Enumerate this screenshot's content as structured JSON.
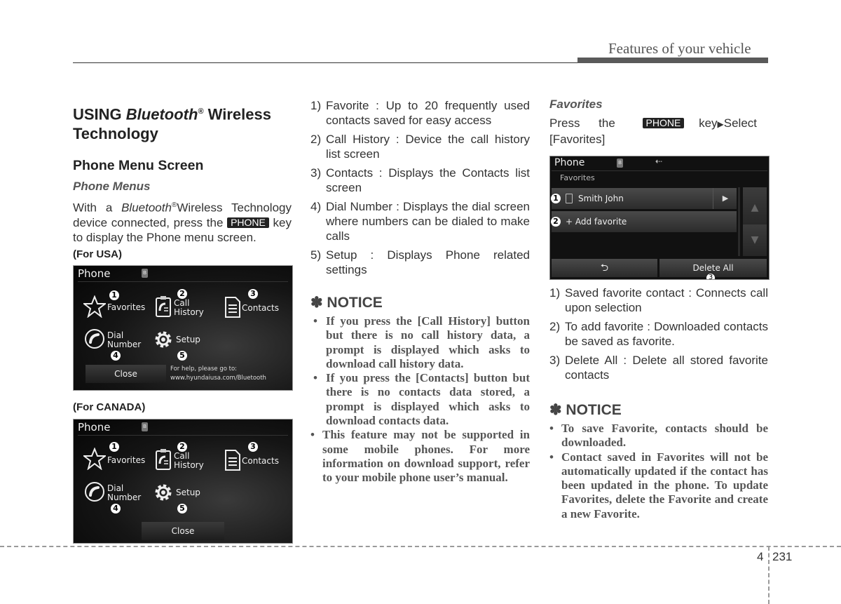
{
  "header": {
    "section_title": "Features of your vehicle"
  },
  "left": {
    "heading_prefix": "USING ",
    "heading_brand": "Bluetooth",
    "heading_reg": "®",
    "heading_suffix": " Wireless Technology",
    "subheading": "Phone Menu Screen",
    "subsubheading": "Phone Menus",
    "intro_1": "With a ",
    "intro_brand": "Bluetooth",
    "intro_reg": "®",
    "intro_2": "Wireless Technology device connected, press the ",
    "intro_key": "PHONE",
    "intro_3": " key to display the Phone menu screen.",
    "usa_label": "(For USA)",
    "canada_label": "(For CANADA)"
  },
  "phone_screen": {
    "title": "Phone",
    "bt_icon": "bluetooth-icon",
    "items": [
      {
        "num": "1",
        "label_1": "Favorites",
        "label_2": "",
        "icon": "star-icon"
      },
      {
        "num": "2",
        "label_1": "Call",
        "label_2": "History",
        "icon": "call-history-icon"
      },
      {
        "num": "3",
        "label_1": "Contacts",
        "label_2": "",
        "icon": "contacts-icon"
      },
      {
        "num": "4",
        "label_1": "Dial",
        "label_2": "Number",
        "icon": "phone-dial-icon"
      },
      {
        "num": "5",
        "label_1": "Setup",
        "label_2": "",
        "icon": "gear-icon"
      }
    ],
    "close_label": "Close",
    "help_line_1": "For help, please go to:",
    "help_line_2": "www.hyundaiusa.com/Bluetooth"
  },
  "middle": {
    "items": [
      {
        "n": "1)",
        "text": "Favorite : Up to 20 frequently used contacts saved for easy access"
      },
      {
        "n": "2)",
        "text": "Call History : Device the call history list screen"
      },
      {
        "n": "3)",
        "text": "Contacts : Displays the Contacts list screen"
      },
      {
        "n": "4)",
        "text": "Dial Number : Displays the dial screen where numbers can be dialed to make calls"
      },
      {
        "n": "5)",
        "text": "Setup : Displays Phone related settings"
      }
    ],
    "notice_title": "✽ NOTICE",
    "notice_bullets": [
      "If you press the [Call History] button but there is no call history data, a prompt is displayed which asks to download call history data.",
      "If you press the [Contacts] button but there is no contacts data stored, a prompt is displayed which asks to download contacts data.",
      "This feature may not be supported in some mobile phones. For more information on download support, refer to your mobile phone user’s manual."
    ]
  },
  "right": {
    "subheading": "Favorites",
    "instr_1": "Press the ",
    "instr_key": "PHONE",
    "instr_2": " key",
    "instr_arrow": "▶",
    "instr_3": "Select [Favorites]",
    "screen": {
      "title": "Phone",
      "subtitle": "Favorites",
      "contact_name": "Smith John",
      "add_label": "+ Add favorite",
      "delete_all_label": "Delete All",
      "back_icon": "back-arrow-icon",
      "callouts": [
        "1",
        "2",
        "3"
      ]
    },
    "items": [
      {
        "n": "1)",
        "text": "Saved favorite contact : Connects call upon selection"
      },
      {
        "n": "2)",
        "text": "To add favorite : Downloaded contacts be saved as favorite."
      },
      {
        "n": "3)",
        "text": "Delete All : Delete all stored favorite contacts"
      }
    ],
    "notice_title": "✽ NOTICE",
    "notice_bullets": [
      "To save Favorite, contacts should be downloaded.",
      "Contact saved in Favorites will not be automatically updated if the contact has been updated in the phone. To update Favorites, delete the Favorite and create a new Favorite."
    ]
  },
  "footer": {
    "chapter": "4",
    "page": "231"
  }
}
